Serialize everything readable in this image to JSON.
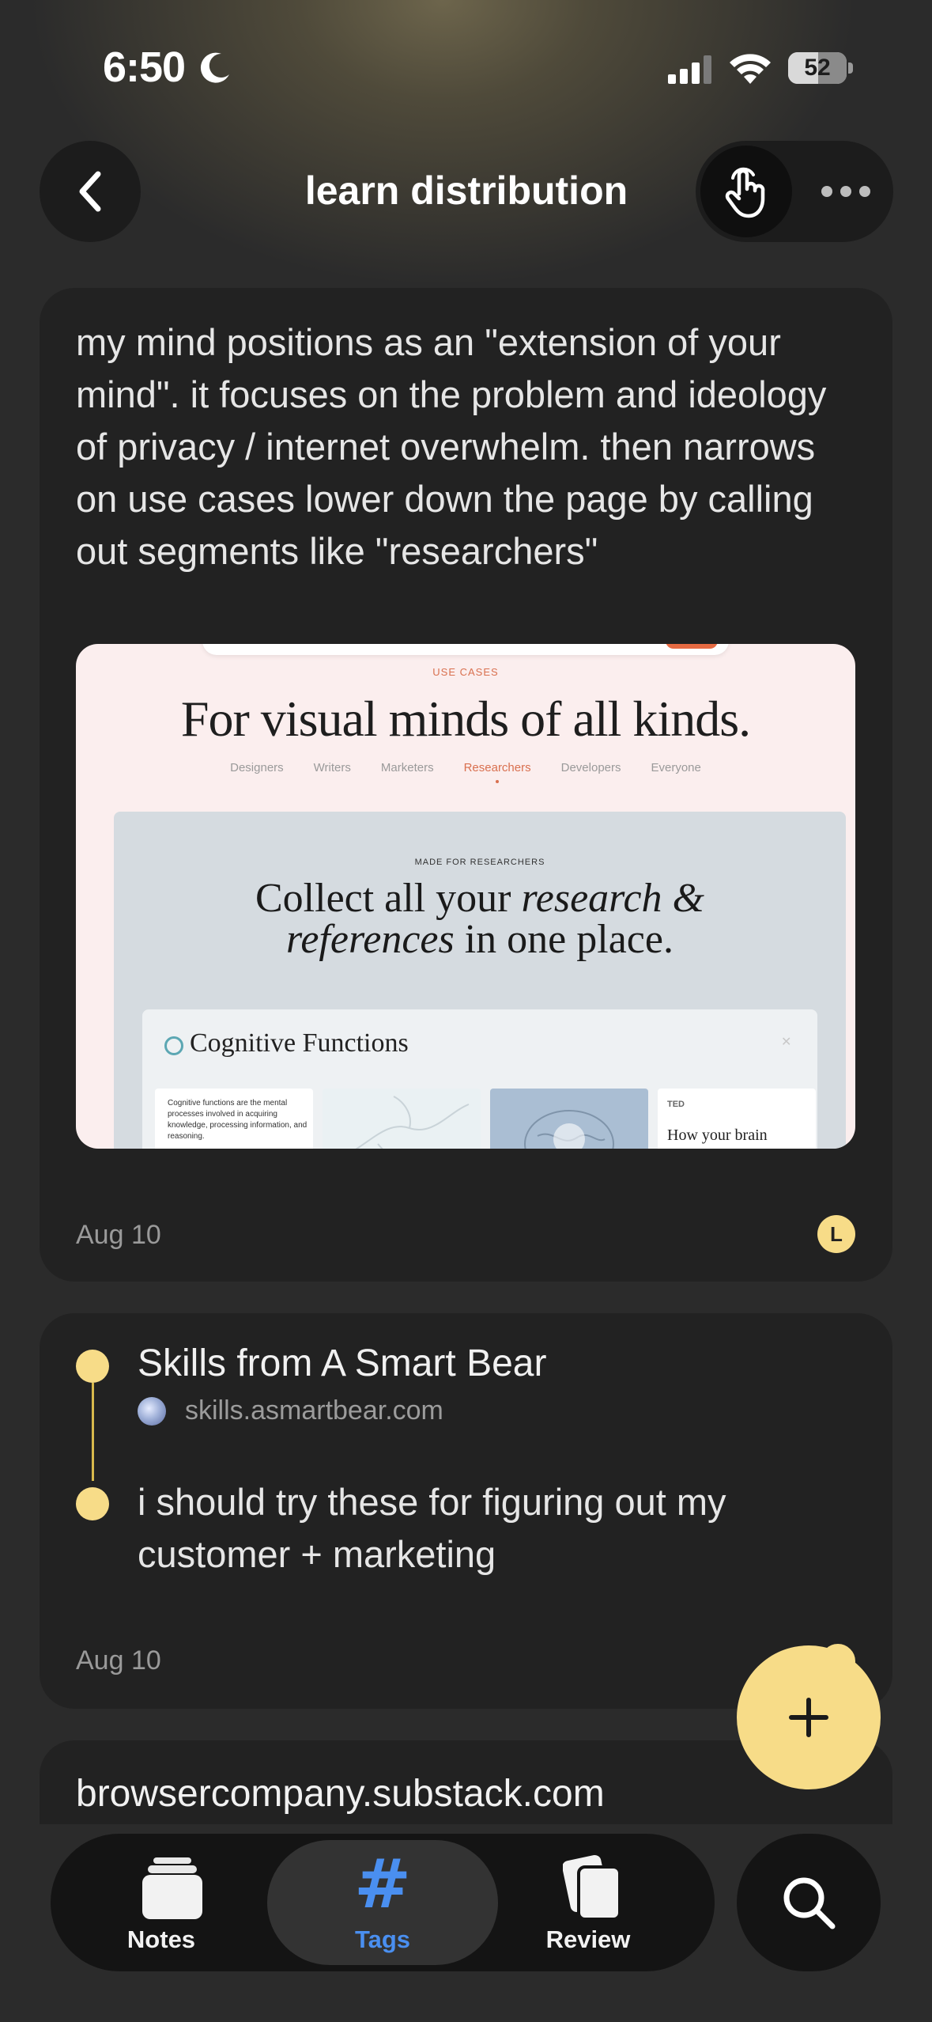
{
  "status_bar": {
    "time": "6:50",
    "battery": "52",
    "battery_level": 0.52
  },
  "header": {
    "title": "learn distribution"
  },
  "cards": [
    {
      "text": "my mind positions as an \"extension of your mind\". it focuses on the problem and ideology of privacy / internet overwhelm. then narrows on use cases lower down the page by calling out segments like \"researchers\"",
      "preview": {
        "eyebrow": "USE CASES",
        "headline": "For visual minds of all kinds.",
        "tabs": [
          "Designers",
          "Writers",
          "Marketers",
          "Researchers",
          "Developers",
          "Everyone"
        ],
        "active_tab": "Researchers",
        "panel_eyebrow": "MADE FOR RESEARCHERS",
        "panel_headline_1": "Collect all your ",
        "panel_headline_1_em": "research &",
        "panel_headline_2_em": "references",
        "panel_headline_2": " in one place.",
        "inner_title": "Cognitive Functions",
        "tile_text": "Cognitive functions are the mental processes involved in acquiring knowledge, processing information, and reasoning.",
        "tile4_label": "TED",
        "tile4_title": "How your brain"
      },
      "date": "Aug 10",
      "avatar_initial": "L"
    },
    {
      "title": "Skills from A Smart Bear",
      "link": "skills.asmartbear.com",
      "note": "i should try these for figuring out my customer + marketing",
      "date": "Aug 10"
    },
    {
      "title": "browsercompany.substack.com"
    }
  ],
  "tabbar": {
    "notes": "Notes",
    "tags": "Tags",
    "review": "Review",
    "active": "Tags"
  },
  "colors": {
    "accent_yellow": "#f7dc88",
    "active_blue": "#4a8ff0",
    "card_bg": "#222222",
    "page_bg": "#2b2b2b"
  }
}
